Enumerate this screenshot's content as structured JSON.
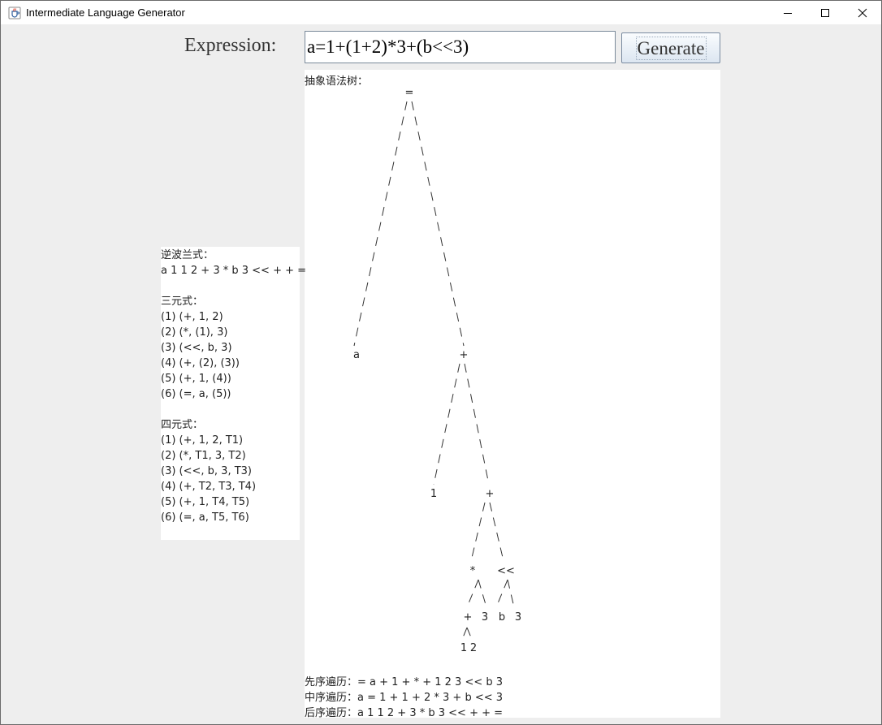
{
  "window": {
    "title": "Intermediate Language Generator",
    "icon": "java-cup-icon"
  },
  "form": {
    "expression_label": "Expression:",
    "expression_value": "a=1+(1+2)*3+(b<<3)",
    "generate_label": "Generate"
  },
  "tree": {
    "title": "抽象语法树：",
    "nodes": [
      {
        "label": "="
      },
      {
        "label": "a"
      },
      {
        "label": "+"
      },
      {
        "label": "1"
      },
      {
        "label": "+"
      },
      {
        "label": "*"
      },
      {
        "label": "<<"
      },
      {
        "label": "+"
      },
      {
        "label": "3"
      },
      {
        "label": "b"
      },
      {
        "label": "3"
      },
      {
        "label": "1"
      },
      {
        "label": "2"
      }
    ],
    "preorder": "先序遍历：= a + 1 + * + 1 2 3 << b 3",
    "inorder": "中序遍历：a = 1 + 1 + 2 * 3 + b << 3",
    "postorder": "后序遍历：a 1 1 2 + 3 * b 3 << + + ="
  },
  "results": {
    "rpn_title": "逆波兰式：",
    "rpn": "a 1 1 2 + 3 * b 3 << + + =",
    "triples_title": "三元式：",
    "triples": [
      "(1) (+, 1, 2)",
      "(2) (*, (1), 3)",
      "(3) (<<, b, 3)",
      "(4) (+, (2), (3))",
      "(5) (+, 1, (4))",
      "(6) (=, a, (5))"
    ],
    "quads_title": "四元式：",
    "quads": [
      "(1) (+, 1, 2, T1)",
      "(2) (*, T1, 3, T2)",
      "(3) (<<, b, 3, T3)",
      "(4) (+, T2, T3, T4)",
      "(5) (+, 1, T4, T5)",
      "(6) (=, a, T5, T6)"
    ]
  },
  "colors": {
    "window_bg": "#eeeeee",
    "panel_bg": "#ffffff",
    "button_gradient_top": "#fafcfe",
    "button_gradient_bottom": "#dce6f1"
  }
}
